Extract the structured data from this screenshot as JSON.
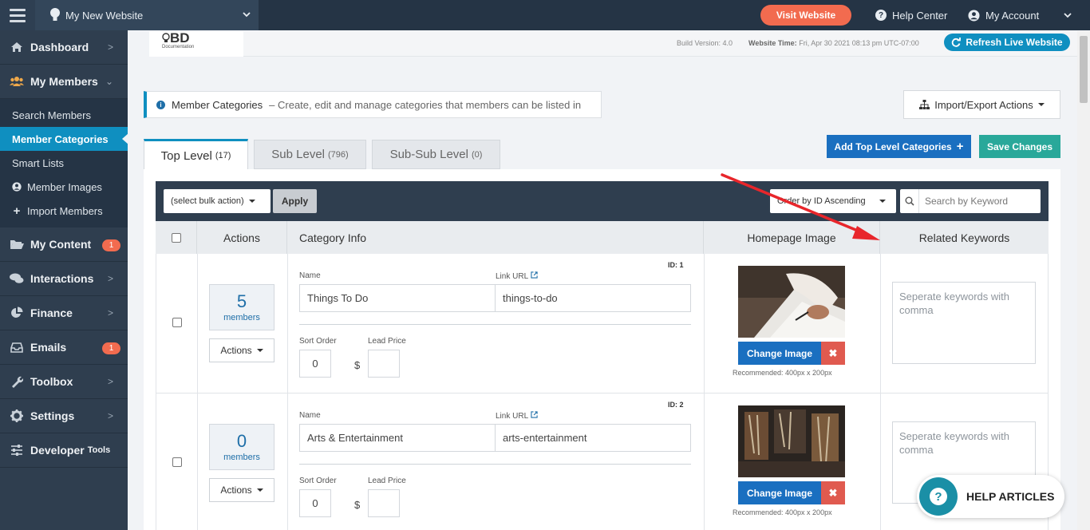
{
  "topbar": {
    "site_name": "My New Website",
    "visit_label": "Visit Website",
    "help_label": "Help Center",
    "account_label": "My Account"
  },
  "sidebar": {
    "dashboard": "Dashboard",
    "my_members": "My Members",
    "sub_items": [
      "Search Members",
      "Member Categories",
      "Smart Lists",
      "Member Images",
      "Import Members"
    ],
    "my_content": "My Content",
    "my_content_badge": "1",
    "interactions": "Interactions",
    "finance": "Finance",
    "emails": "Emails",
    "emails_badge": "1",
    "toolbox": "Toolbox",
    "settings": "Settings",
    "developer": "Developer",
    "developer_small": "Tools"
  },
  "header": {
    "logo_text": "BD",
    "logo_sub": "Documentation",
    "build_version": "Build Version: 4.0",
    "website_time_label": "Website Time:",
    "website_time_value": "Fri, Apr 30 2021 08:13 pm UTC-07:00",
    "refresh_label": "Refresh Live Website"
  },
  "notice": {
    "title": "Member Categories",
    "text": "– Create, edit and manage categories that members can be listed in"
  },
  "import_export_label": "Import/Export Actions",
  "tabs": [
    {
      "label": "Top Level",
      "count": "(17)"
    },
    {
      "label": "Sub Level",
      "count": "(796)"
    },
    {
      "label": "Sub-Sub Level",
      "count": "(0)"
    }
  ],
  "add_top_level_label": "Add Top Level Categories",
  "save_changes_label": "Save Changes",
  "toolbar": {
    "bulk_action": "(select bulk action)",
    "apply": "Apply",
    "order": "Order by ID Ascending",
    "search_placeholder": "Search by Keyword"
  },
  "table": {
    "headers": {
      "actions": "Actions",
      "category_info": "Category Info",
      "homepage_image": "Homepage Image",
      "related_keywords": "Related Keywords"
    },
    "labels": {
      "name": "Name",
      "link_url": "Link URL",
      "sort_order": "Sort Order",
      "lead_price": "Lead Price",
      "dollar": "$",
      "members": "members",
      "actions_btn": "Actions",
      "change_image": "Change Image",
      "remove": "✖",
      "recommended": "Recommended: 400px x 200px",
      "keywords_placeholder": "Seperate keywords with comma"
    },
    "rows": [
      {
        "id": "ID: 1",
        "members": "5",
        "name": "Things To Do",
        "link": "things-to-do",
        "sort_order": "0",
        "lead_price": ""
      },
      {
        "id": "ID: 2",
        "members": "0",
        "name": "Arts & Entertainment",
        "link": "arts-entertainment",
        "sort_order": "0",
        "lead_price": ""
      }
    ]
  },
  "help_articles_label": "HELP ARTICLES",
  "colors": {
    "topbar": "#253445",
    "sidebar": "#2f3e4f",
    "accent_blue": "#0f8fc0",
    "primary_button": "#1a6fc0",
    "save_green": "#29a89a",
    "visit_orange": "#f26b4f",
    "arrow_red": "#e8262b"
  }
}
